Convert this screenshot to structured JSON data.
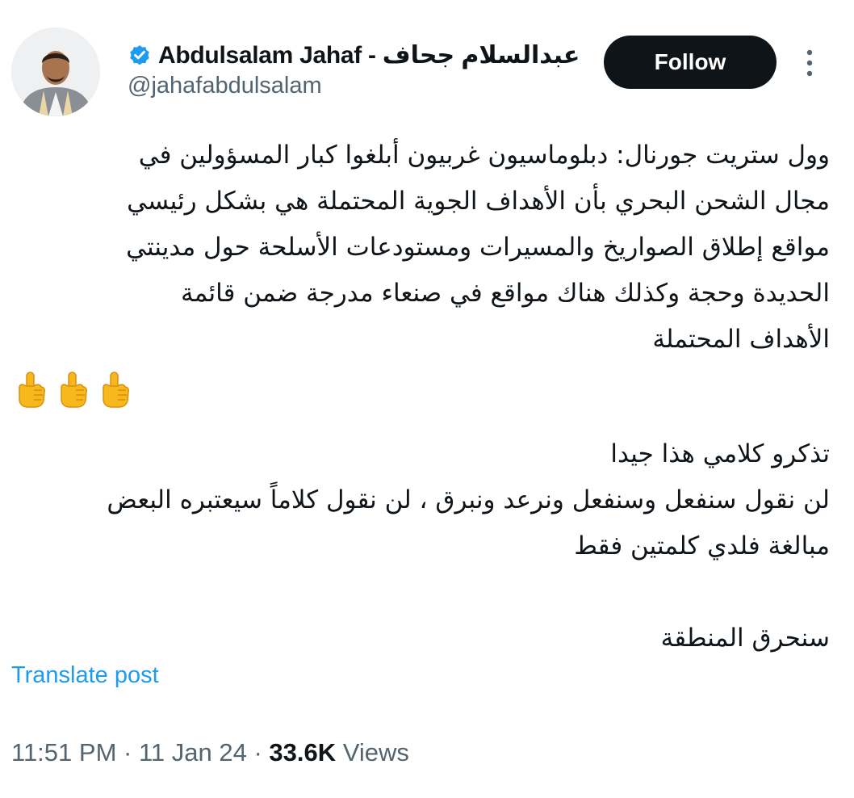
{
  "author": {
    "display_name": "Abdulsalam Jahaf - عبدالسلام جحاف",
    "handle": "@jahafabdulsalam",
    "verified_icon": "verified-badge-icon",
    "verified_color": "#1d9bf0"
  },
  "actions": {
    "follow_label": "Follow",
    "more_icon": "more-vertical-icon"
  },
  "post": {
    "lines": [
      "وول ستريت جورنال: دبلوماسيون غربيون أبلغوا كبار المسؤولين في",
      "مجال الشحن البحري بأن الأهداف الجوية المحتملة هي بشكل رئيسي",
      "مواقع إطلاق الصواريخ والمسيرات ومستودعات الأسلحة حول مدينتي",
      "الحديدة وحجة وكذلك هناك مواقع في صنعاء مدرجة ضمن قائمة",
      "الأهداف المحتملة"
    ],
    "emoji": [
      "👆",
      "👆",
      "👆"
    ],
    "emoji_icon": "pointing-finger-icon",
    "lines2": [
      "تذكرو كلامي هذا جيدا",
      "لن نقول سنفعل وسنفعل ونرعد ونبرق ، لن نقول كلاماً سيعتبره البعض",
      "مبالغة فلدي كلمتين فقط"
    ],
    "lines3": [
      "سنحرق المنطقة"
    ]
  },
  "translate_label": "Translate post",
  "meta": {
    "time": "11:51 PM",
    "separator": "·",
    "date": "11 Jan 24",
    "views_count": "33.6K",
    "views_label": "Views"
  },
  "colors": {
    "text": "#0f1419",
    "secondary": "#536471",
    "link": "#1d9bf0",
    "button_bg": "#0f1419"
  }
}
